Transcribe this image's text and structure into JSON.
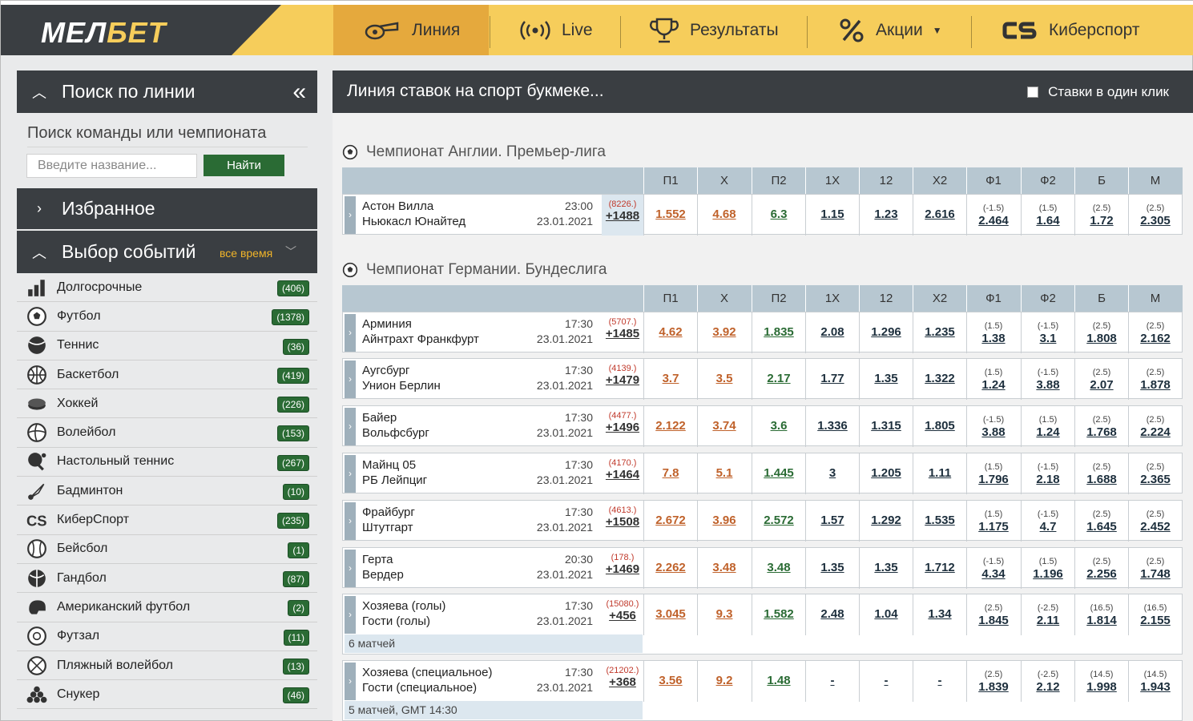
{
  "brand": {
    "logo_white": "МЕЛ",
    "logo_accent": "БЕТ"
  },
  "nav": [
    {
      "label": "Линия",
      "icon": "whistle-icon",
      "active": true
    },
    {
      "label": "Live",
      "icon": "broadcast-icon"
    },
    {
      "label": "Результаты",
      "icon": "trophy-icon"
    },
    {
      "label": "Акции",
      "icon": "percent-icon",
      "dropdown": true
    },
    {
      "label": "Киберспорт",
      "icon": "cs-icon"
    }
  ],
  "sidebar": {
    "search_header": "Поиск по линии",
    "search_label": "Поиск команды или чемпионата",
    "search_placeholder": "Введите название...",
    "search_button": "Найти",
    "favorites": "Избранное",
    "events_header": "Выбор событий",
    "period": "все время",
    "sports": [
      {
        "name": "Долгосрочные",
        "count": "406",
        "icon": "long-term-icon"
      },
      {
        "name": "Футбол",
        "count": "1378",
        "icon": "football-icon"
      },
      {
        "name": "Теннис",
        "count": "36",
        "icon": "tennis-icon"
      },
      {
        "name": "Баскетбол",
        "count": "419",
        "icon": "basketball-icon"
      },
      {
        "name": "Хоккей",
        "count": "226",
        "icon": "hockey-icon"
      },
      {
        "name": "Волейбол",
        "count": "153",
        "icon": "volleyball-icon"
      },
      {
        "name": "Настольный теннис",
        "count": "267",
        "icon": "table-tennis-icon"
      },
      {
        "name": "Бадминтон",
        "count": "10",
        "icon": "badminton-icon"
      },
      {
        "name": "КиберСпорт",
        "count": "235",
        "icon": "esports-icon"
      },
      {
        "name": "Бейсбол",
        "count": "1",
        "icon": "baseball-icon"
      },
      {
        "name": "Гандбол",
        "count": "87",
        "icon": "handball-icon"
      },
      {
        "name": "Американский футбол",
        "count": "2",
        "icon": "american-football-icon"
      },
      {
        "name": "Футзал",
        "count": "11",
        "icon": "futsal-icon"
      },
      {
        "name": "Пляжный волейбол",
        "count": "13",
        "icon": "beach-volleyball-icon"
      },
      {
        "name": "Снукер",
        "count": "46",
        "icon": "snooker-icon"
      }
    ]
  },
  "main": {
    "title": "Линия ставок на спорт букмеке...",
    "one_click": "Ставки в один клик",
    "columns": [
      "П1",
      "Х",
      "П2",
      "1Х",
      "12",
      "Х2",
      "Ф1",
      "Ф2",
      "Б",
      "М"
    ],
    "leagues": [
      {
        "name": "Чемпионат Англии. Премьер-лига",
        "events": [
          {
            "t1": "Астон Вилла",
            "t2": "Ньюкасл Юнайтед",
            "time": "23:00",
            "date": "23.01.2021",
            "cnt": "(8226.)",
            "more": "+1488",
            "odds": [
              "1.552",
              "4.68",
              "6.3",
              "1.15",
              "1.23",
              "2.616"
            ],
            "hcp": [
              [
                "(-1.5)",
                "2.464"
              ],
              [
                "(1.5)",
                "1.64"
              ],
              [
                "(2.5)",
                "1.72"
              ],
              [
                "(2.5)",
                "2.305"
              ]
            ]
          }
        ]
      },
      {
        "name": "Чемпионат Германии. Бундеслига",
        "events": [
          {
            "t1": "Арминия",
            "t2": "Айнтрахт Франкфурт",
            "time": "17:30",
            "date": "23.01.2021",
            "cnt": "(5707.)",
            "more": "+1485",
            "odds": [
              "4.62",
              "3.92",
              "1.835",
              "2.08",
              "1.296",
              "1.235"
            ],
            "hcp": [
              [
                "(1.5)",
                "1.38"
              ],
              [
                "(-1.5)",
                "3.1"
              ],
              [
                "(2.5)",
                "1.808"
              ],
              [
                "(2.5)",
                "2.162"
              ]
            ]
          },
          {
            "t1": "Аугсбург",
            "t2": "Унион Берлин",
            "time": "17:30",
            "date": "23.01.2021",
            "cnt": "(4139.)",
            "more": "+1479",
            "odds": [
              "3.7",
              "3.5",
              "2.17",
              "1.77",
              "1.35",
              "1.322"
            ],
            "hcp": [
              [
                "(1.5)",
                "1.24"
              ],
              [
                "(-1.5)",
                "3.88"
              ],
              [
                "(2.5)",
                "2.07"
              ],
              [
                "(2.5)",
                "1.878"
              ]
            ]
          },
          {
            "t1": "Байер",
            "t2": "Вольфсбург",
            "time": "17:30",
            "date": "23.01.2021",
            "cnt": "(4477.)",
            "more": "+1496",
            "odds": [
              "2.122",
              "3.74",
              "3.6",
              "1.336",
              "1.315",
              "1.805"
            ],
            "hcp": [
              [
                "(-1.5)",
                "3.88"
              ],
              [
                "(1.5)",
                "1.24"
              ],
              [
                "(2.5)",
                "1.768"
              ],
              [
                "(2.5)",
                "2.224"
              ]
            ]
          },
          {
            "t1": "Майнц 05",
            "t2": "РБ Лейпциг",
            "time": "17:30",
            "date": "23.01.2021",
            "cnt": "(4170.)",
            "more": "+1464",
            "odds": [
              "7.8",
              "5.1",
              "1.445",
              "3",
              "1.205",
              "1.11"
            ],
            "hcp": [
              [
                "(1.5)",
                "1.796"
              ],
              [
                "(-1.5)",
                "2.18"
              ],
              [
                "(2.5)",
                "1.688"
              ],
              [
                "(2.5)",
                "2.365"
              ]
            ]
          },
          {
            "t1": "Фрайбург",
            "t2": "Штутгарт",
            "time": "17:30",
            "date": "23.01.2021",
            "cnt": "(4613.)",
            "more": "+1508",
            "odds": [
              "2.672",
              "3.96",
              "2.572",
              "1.57",
              "1.292",
              "1.535"
            ],
            "hcp": [
              [
                "(1.5)",
                "1.175"
              ],
              [
                "(-1.5)",
                "4.7"
              ],
              [
                "(2.5)",
                "1.645"
              ],
              [
                "(2.5)",
                "2.452"
              ]
            ]
          },
          {
            "t1": "Герта",
            "t2": "Вердер",
            "time": "20:30",
            "date": "23.01.2021",
            "cnt": "(178.)",
            "more": "+1469",
            "odds": [
              "2.262",
              "3.48",
              "3.48",
              "1.35",
              "1.35",
              "1.712"
            ],
            "hcp": [
              [
                "(-1.5)",
                "4.34"
              ],
              [
                "(1.5)",
                "1.196"
              ],
              [
                "(2.5)",
                "2.256"
              ],
              [
                "(2.5)",
                "1.748"
              ]
            ]
          },
          {
            "t1": "Хозяева (голы)",
            "t2": "Гости (голы)",
            "time": "17:30",
            "date": "23.01.2021",
            "cnt": "(15080.)",
            "more": "+456",
            "odds": [
              "3.045",
              "9.3",
              "1.582",
              "2.48",
              "1.04",
              "1.34"
            ],
            "hcp": [
              [
                "(2.5)",
                "1.845"
              ],
              [
                "(-2.5)",
                "2.11"
              ],
              [
                "(16.5)",
                "1.814"
              ],
              [
                "(16.5)",
                "2.155"
              ]
            ],
            "sub": "6 матчей"
          },
          {
            "t1": "Хозяева (специальное)",
            "t2": "Гости (специальное)",
            "time": "17:30",
            "date": "23.01.2021",
            "cnt": "(21202.)",
            "more": "+368",
            "odds": [
              "3.56",
              "9.2",
              "1.48",
              "-",
              "-",
              "-"
            ],
            "hcp": [
              [
                "(2.5)",
                "1.839"
              ],
              [
                "(-2.5)",
                "2.12"
              ],
              [
                "(14.5)",
                "1.998"
              ],
              [
                "(14.5)",
                "1.943"
              ]
            ],
            "sub": "5 матчей, GMT 14:30"
          }
        ]
      }
    ]
  }
}
